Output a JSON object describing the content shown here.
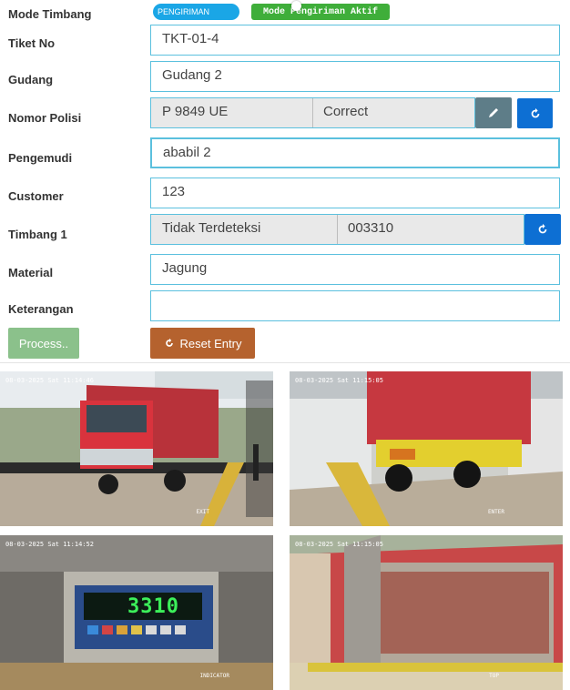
{
  "form": {
    "mode_label": "Mode Timbang",
    "mode_badge": "PENGIRIMAN",
    "mode_status": "Mode Pengiriman Aktif",
    "tiket_label": "Tiket No",
    "tiket_value": "TKT-01-4",
    "gudang_label": "Gudang",
    "gudang_value": "Gudang 2",
    "nopol_label": "Nomor Polisi",
    "nopol_value": "P 9849 UE",
    "nopol_status": "Correct",
    "pengemudi_label": "Pengemudi",
    "pengemudi_value": "ababil 2",
    "customer_label": "Customer",
    "customer_value": "123",
    "timbang_label": "Timbang 1",
    "timbang_status": "Tidak Terdeteksi",
    "timbang_value": "003310",
    "material_label": "Material",
    "material_value": "Jagung",
    "keterangan_label": "Keterangan",
    "keterangan_value": "",
    "process_label": "Process..",
    "reset_label": "Reset Entry"
  },
  "cameras": [
    {
      "timestamp": "08-03-2025 Sat 11:14:46",
      "name": "EXIT"
    },
    {
      "timestamp": "08-03-2025 Sat 11:15:05",
      "name": "ENTER"
    },
    {
      "timestamp": "08-03-2025 Sat 11:14:52",
      "name": "INDICATOR"
    },
    {
      "timestamp": "08-03-2025 Sat 11:15:05",
      "name": "TOP"
    }
  ],
  "indicator_display": "3310",
  "colors": {
    "accent": "#5bc0de",
    "primary": "#0d6fd3",
    "success": "#3fae3a",
    "warning": "#b5622e"
  }
}
